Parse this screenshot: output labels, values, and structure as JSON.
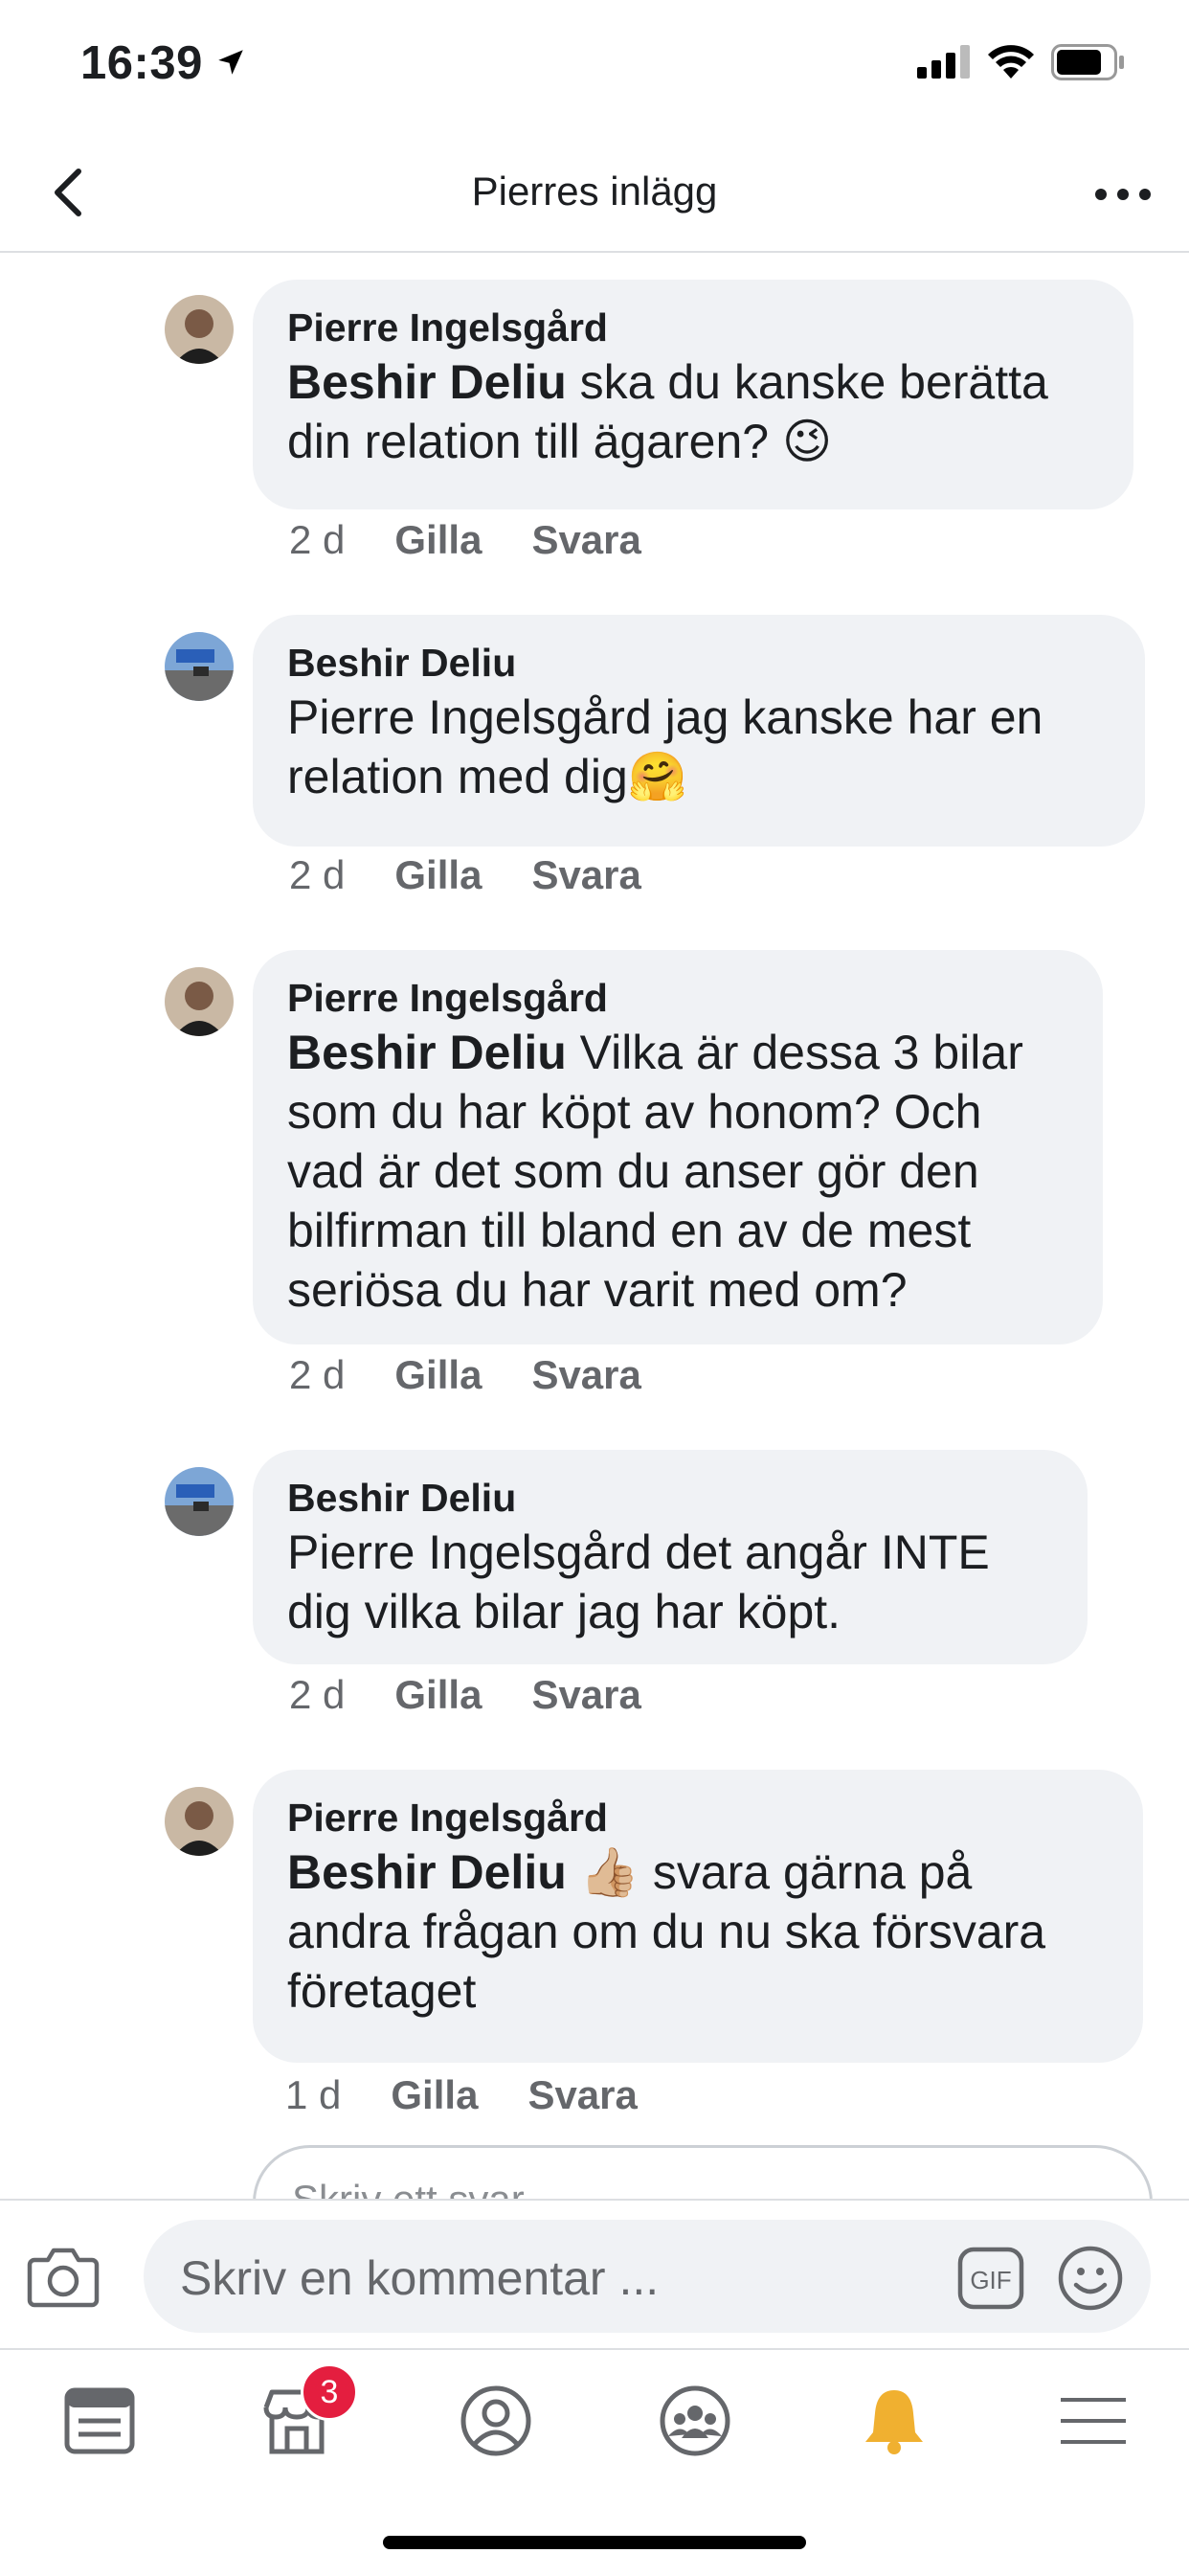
{
  "status_bar": {
    "time": "16:39"
  },
  "header": {
    "title": "Pierres inlägg"
  },
  "comments": [
    {
      "author": "Pierre Ingelsgård",
      "mention": "Beshir Deliu",
      "line1": " ska du kanske berätta",
      "line2": "din relation till ägaren? ",
      "emoji": "😉",
      "time": "2 d",
      "like": "Gilla",
      "reply": "Svara"
    },
    {
      "author": "Beshir Deliu",
      "line1": "Pierre Ingelsgård  jag kanske har en",
      "line2": "relation med dig",
      "emoji": "🤗",
      "time": "2 d",
      "like": "Gilla",
      "reply": "Svara"
    },
    {
      "author": "Pierre Ingelsgård",
      "mention": "Beshir Deliu",
      "line1": " Vilka är dessa 3 bilar",
      "line2": "som du har köpt av honom? Och",
      "line3": "vad är det som du anser gör den",
      "line4": "bilfirman till bland en av de mest",
      "line5": "seriösa du har varit med om?",
      "time": "2 d",
      "like": "Gilla",
      "reply": "Svara"
    },
    {
      "author": "Beshir Deliu",
      "line1": "Pierre Ingelsgård  det angår INTE",
      "line2": "dig vilka bilar jag har köpt.",
      "time": "2 d",
      "like": "Gilla",
      "reply": "Svara"
    },
    {
      "author": "Pierre Ingelsgård",
      "mention": "Beshir Deliu",
      "emoji": "👍🏼",
      "line1": " svara gärna på",
      "line2": "andra frågan om du nu ska försvara",
      "line3": "företaget",
      "time": "1 d",
      "like": "Gilla",
      "reply": "Svara"
    }
  ],
  "reply_box": {
    "placeholder": "Skriv ett svar ..."
  },
  "composer": {
    "placeholder": "Skriv en kommentar ...",
    "gif_label": "GIF"
  },
  "tab_bar": {
    "tabs": [
      "news-feed",
      "marketplace",
      "profile",
      "groups",
      "notifications",
      "menu"
    ],
    "marketplace_badge": "3",
    "active_color": "#f0b030"
  },
  "colors": {
    "bubble": "#f0f2f5",
    "secondary_text": "#65676b",
    "badge": "#e41e3f"
  }
}
